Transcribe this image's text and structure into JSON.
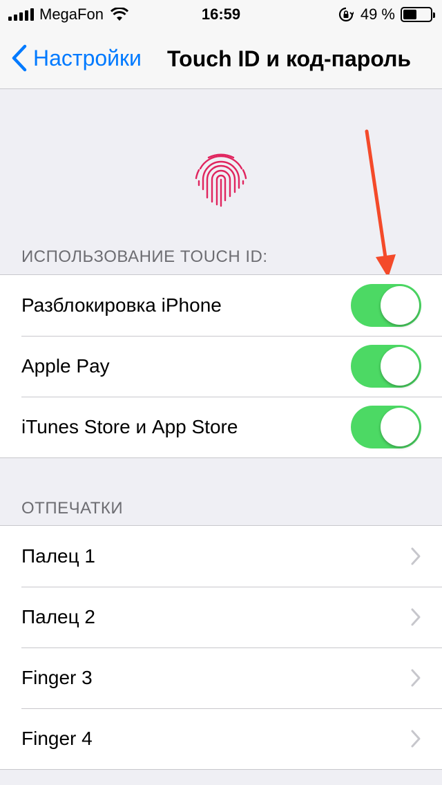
{
  "status_bar": {
    "carrier": "MegaFon",
    "time": "16:59",
    "battery_percent": "49 %",
    "battery_level": 0.49
  },
  "nav": {
    "back_label": "Настройки",
    "title": "Touch ID и код-пароль"
  },
  "touch_id": {
    "section_header": "ИСПОЛЬЗОВАНИЕ TOUCH ID:",
    "items": [
      {
        "label": "Разблокировка iPhone",
        "on": true
      },
      {
        "label": "Apple Pay",
        "on": true
      },
      {
        "label": "iTunes Store и App Store",
        "on": true
      }
    ]
  },
  "fingerprints": {
    "section_header": "ОТПЕЧАТКИ",
    "items": [
      {
        "label": "Палец 1"
      },
      {
        "label": "Палец 2"
      },
      {
        "label": "Finger 3"
      },
      {
        "label": "Finger 4"
      }
    ]
  },
  "colors": {
    "accent": "#007aff",
    "toggle_on": "#4cd964",
    "fingerprint": "#e0245e",
    "annotation_arrow": "#f44a2a"
  }
}
